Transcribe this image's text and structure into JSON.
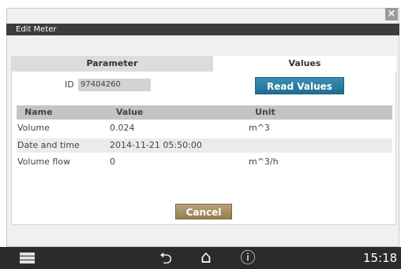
{
  "window": {
    "title": "Edit Meter",
    "close_label": "×"
  },
  "tabs": [
    {
      "label": "Parameter",
      "active": false
    },
    {
      "label": "Values",
      "active": true
    }
  ],
  "id_field": {
    "label": "ID",
    "value": "97404260"
  },
  "read_button": {
    "label": "Read Values"
  },
  "table": {
    "columns": [
      "Name",
      "Value",
      "Unit"
    ],
    "rows": [
      {
        "name": "Volume",
        "value": "0.024",
        "unit": "m^3"
      },
      {
        "name": "Date and time",
        "value": "2014-11-21 05:50:00",
        "unit": ""
      },
      {
        "name": "Volume flow",
        "value": "0",
        "unit": "m^3/h"
      }
    ]
  },
  "cancel_button": {
    "label": "Cancel"
  },
  "navbar": {
    "menu_icon": "menu-icon",
    "back_icon": "back-icon",
    "home_icon": "home-icon",
    "info_icon": "info-icon",
    "back_glyph": "⮌",
    "home_glyph": "⌂",
    "info_glyph": "ⓘ",
    "time": "15:18"
  },
  "colors": {
    "title_bar": "#3c3c3c",
    "read_button": "#1f6f92",
    "cancel_button": "#94804f",
    "nav_bar": "#2b2b2b"
  }
}
